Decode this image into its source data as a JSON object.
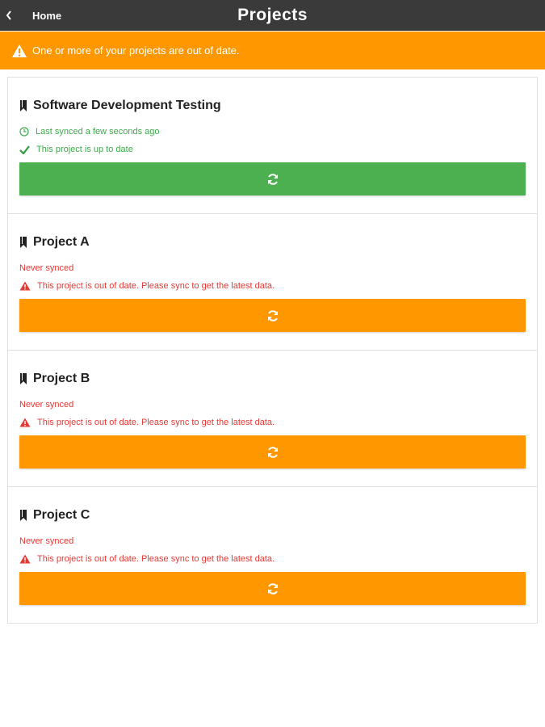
{
  "navbar": {
    "back_label": "Home",
    "title": "Projects"
  },
  "banner": {
    "icon": "warning-icon",
    "text": "One or more of your projects are out of date."
  },
  "colors": {
    "navbar_bg": "#3a3a3a",
    "accent_orange": "#ff9800",
    "success_green": "#4caf50",
    "error_red": "#e53935"
  },
  "projects": [
    {
      "name": "Software Development Testing",
      "sync_text": "Last synced a few seconds ago",
      "status_text": "This project is up to date",
      "state": "up-to-date"
    },
    {
      "name": "Project A",
      "sync_text": "Never synced",
      "status_text": "This project is out of date. Please sync to get the latest data.",
      "state": "out-of-date"
    },
    {
      "name": "Project B",
      "sync_text": "Never synced",
      "status_text": "This project is out of date. Please sync to get the latest data.",
      "state": "out-of-date"
    },
    {
      "name": "Project C",
      "sync_text": "Never synced",
      "status_text": "This project is out of date. Please sync to get the latest data.",
      "state": "out-of-date"
    }
  ]
}
